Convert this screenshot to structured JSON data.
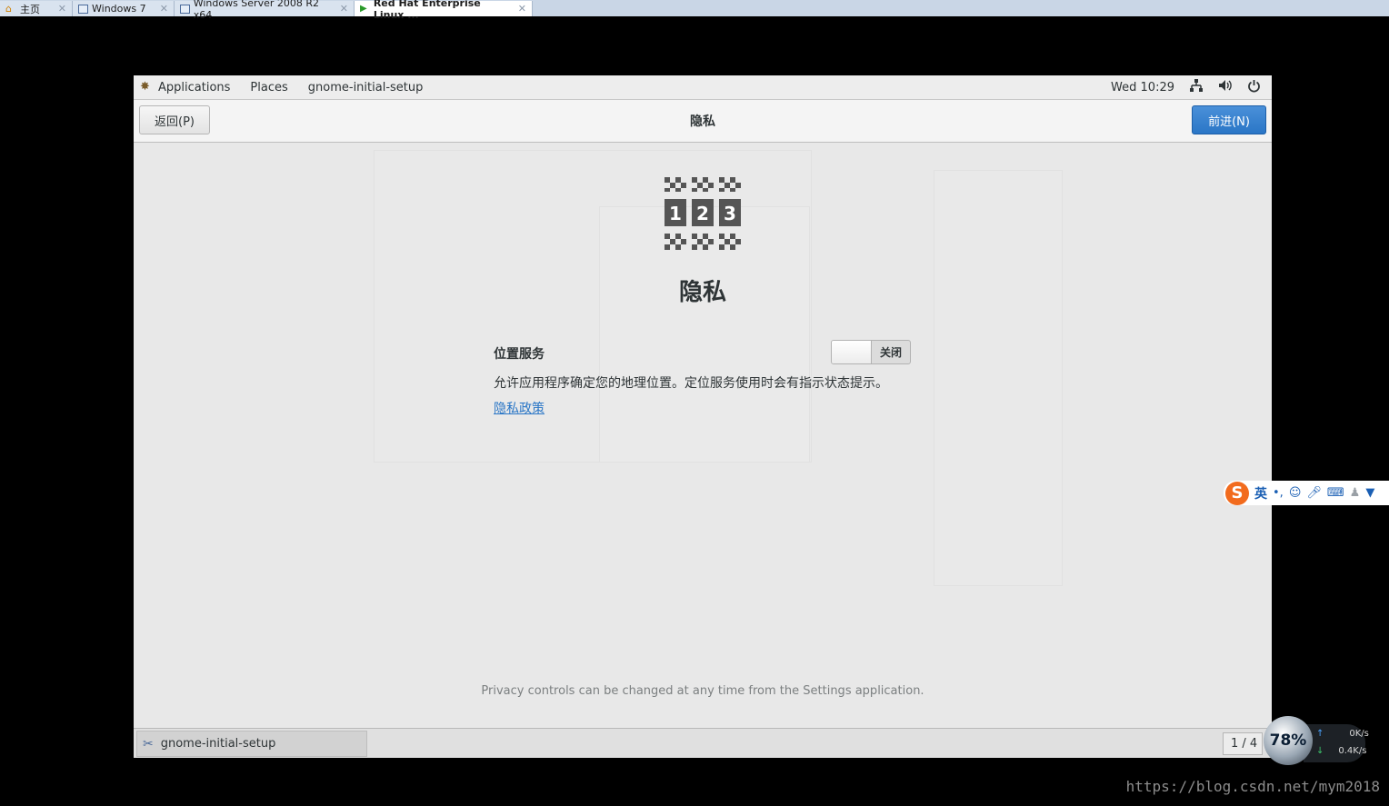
{
  "vm_tabs": [
    {
      "label": "主页",
      "icon": "home-icon",
      "active": false
    },
    {
      "label": "Windows 7",
      "icon": "vm-icon",
      "active": false
    },
    {
      "label": "Windows Server 2008 R2 x64",
      "icon": "vm-icon",
      "active": false
    },
    {
      "label": "Red Hat Enterprise Linux ...",
      "icon": "vm-running-icon",
      "active": true
    }
  ],
  "topbar": {
    "applications": "Applications",
    "places": "Places",
    "app_name": "gnome-initial-setup",
    "clock": "Wed 10:29",
    "icons": [
      "network-icon",
      "volume-icon",
      "power-icon"
    ]
  },
  "headerbar": {
    "back_label": "返回(P)",
    "title": "隐私",
    "next_label": "前进(N)"
  },
  "content": {
    "logo_icon": "privacy-123-icon",
    "heading": "隐私",
    "location_label": "位置服务",
    "switch_state": "关闭",
    "location_desc": "允许应用程序确定您的地理位置。定位服务使用时会有指示状态提示。",
    "policy_link": "隐私政策",
    "footer_note": "Privacy controls can be changed at any time from the Settings application."
  },
  "taskbar": {
    "task_label": "gnome-initial-setup",
    "workspace": "1 / 4"
  },
  "ime": {
    "logo": "S",
    "lang": "英",
    "icons": [
      "punctuation-icon",
      "emoji-icon",
      "microphone-icon",
      "keyboard-icon",
      "user-icon",
      "skin-icon"
    ]
  },
  "netmon": {
    "percent": "78%",
    "upload": "0K/s",
    "download": "0.4K/s"
  },
  "watermark": "https://blog.csdn.net/mym2018",
  "colors": {
    "accent": "#2a76c6",
    "guest_bg": "#e8e8e8",
    "ime_brand": "#f26b1d"
  }
}
